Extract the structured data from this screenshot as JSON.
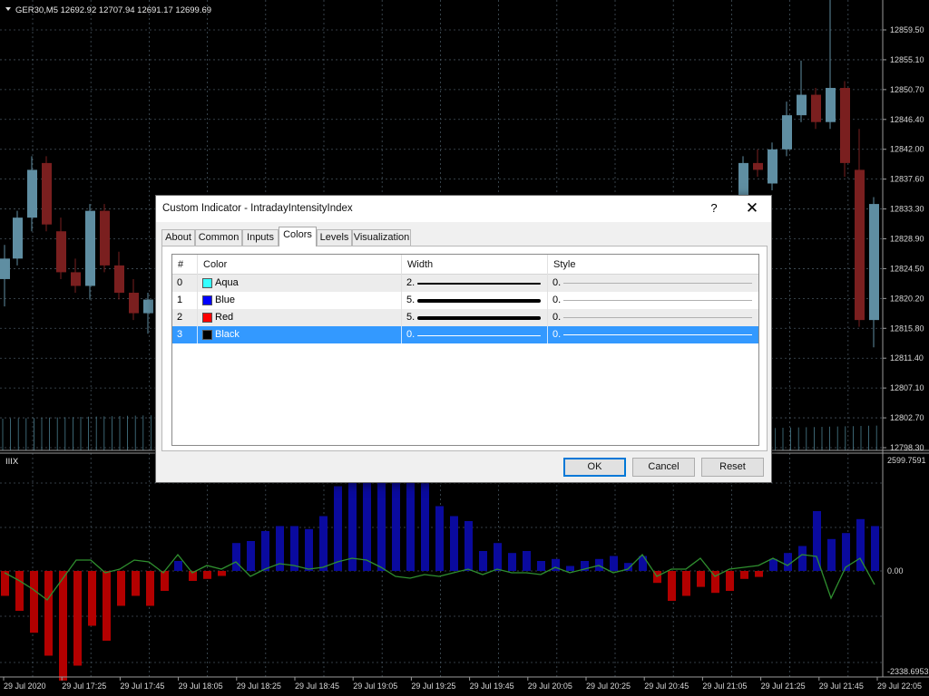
{
  "chart": {
    "title": "GER30,M5  12692.92 12707.94 12691.17 12699.69",
    "indicator_label": "IIIX",
    "price_labels": [
      "12859.50",
      "12855.10",
      "12850.70",
      "12846.40",
      "12842.00",
      "12837.60",
      "12833.30",
      "12828.90",
      "12824.50",
      "12820.20",
      "12815.80",
      "12811.40",
      "12807.10",
      "12802.70",
      "12798.30"
    ],
    "indicator_labels": [
      "2599.7591",
      "0.00",
      "-2338.6953"
    ],
    "time_labels": [
      "29 Jul 2020",
      "29 Jul 17:25",
      "29 Jul 17:45",
      "29 Jul 18:05",
      "29 Jul 18:25",
      "29 Jul 18:45",
      "29 Jul 19:05",
      "29 Jul 19:25",
      "29 Jul 19:45",
      "29 Jul 20:05",
      "29 Jul 20:25",
      "29 Jul 20:45",
      "29 Jul 21:05",
      "29 Jul 21:25",
      "29 Jul 21:45",
      "29 Jul 22:05"
    ],
    "colors": {
      "background": "#000000",
      "grid": "#44525c",
      "bull": "#5f8ea2",
      "bear": "#7a1f1f",
      "positive_hist": "#0a0a9e",
      "negative_hist": "#b30000",
      "signal_line": "#2f8f2f"
    }
  },
  "dialog": {
    "title": "Custom Indicator - IntradayIntensityIndex",
    "help": "?",
    "close": "✕",
    "tabs": [
      "About",
      "Common",
      "Inputs",
      "Colors",
      "Levels",
      "Visualization"
    ],
    "active_tab": "Colors",
    "columns": [
      "#",
      "Color",
      "Width",
      "Style"
    ],
    "rows": [
      {
        "index": "0",
        "color_name": "Aqua",
        "color": "#33ffff",
        "width": "2.",
        "width_level": 2,
        "style": "0."
      },
      {
        "index": "1",
        "color_name": "Blue",
        "color": "#0000ff",
        "width": "5.",
        "width_level": 5,
        "style": "0."
      },
      {
        "index": "2",
        "color_name": "Red",
        "color": "#ff0000",
        "width": "5.",
        "width_level": 5,
        "style": "0."
      },
      {
        "index": "3",
        "color_name": "Black",
        "color": "#000000",
        "width": "0.",
        "width_level": 0,
        "style": "0.",
        "selected": true
      }
    ],
    "buttons": {
      "ok": "OK",
      "cancel": "Cancel",
      "reset": "Reset"
    }
  }
}
